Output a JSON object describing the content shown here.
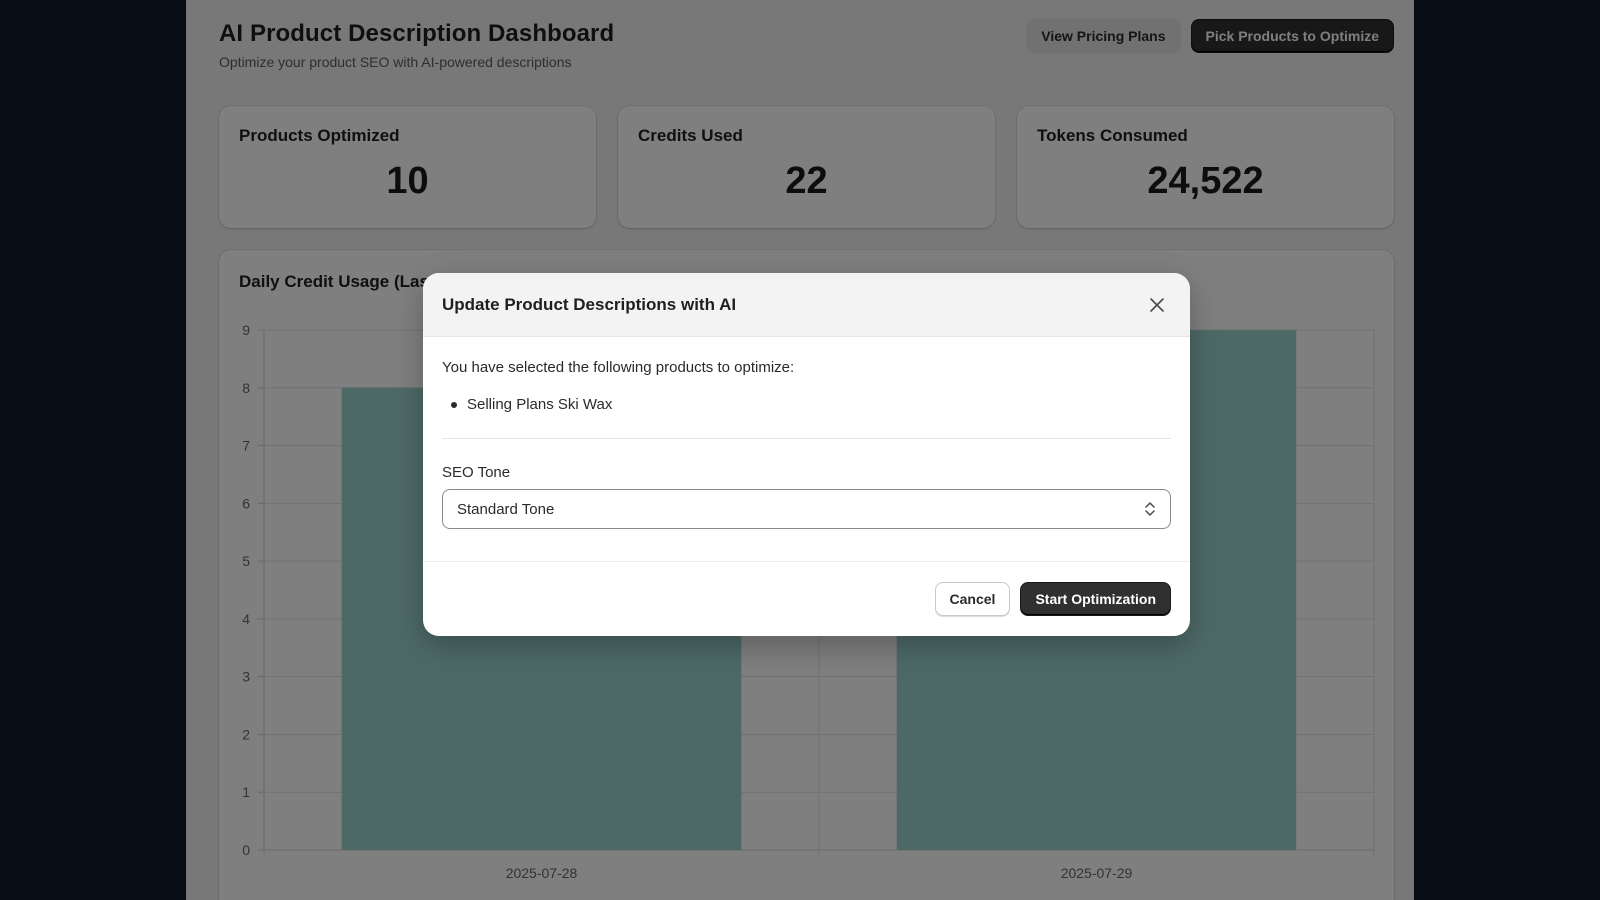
{
  "header": {
    "title": "AI Product Description Dashboard",
    "subtitle": "Optimize your product SEO with AI-powered descriptions",
    "view_pricing_label": "View Pricing Plans",
    "pick_products_label": "Pick Products to Optimize"
  },
  "stats": [
    {
      "label": "Products Optimized",
      "value": "10"
    },
    {
      "label": "Credits Used",
      "value": "22"
    },
    {
      "label": "Tokens Consumed",
      "value": "24,522"
    }
  ],
  "chart_card": {
    "title_visible": "Daily Credit Usage (Las"
  },
  "chart_data": {
    "type": "bar",
    "categories": [
      "2025-07-28",
      "2025-07-29"
    ],
    "values": [
      8,
      9
    ],
    "ylim": [
      0,
      9
    ],
    "yticks": [
      0,
      1,
      2,
      3,
      4,
      5,
      6,
      7,
      8,
      9
    ],
    "grid": true,
    "bar_color": "#9ad3cd"
  },
  "modal": {
    "title": "Update Product Descriptions with AI",
    "intro": "You have selected the following products to optimize:",
    "products": [
      "Selling Plans Ski Wax"
    ],
    "seo_label": "SEO Tone",
    "seo_value": "Standard Tone",
    "cancel_label": "Cancel",
    "start_label": "Start Optimization"
  },
  "icons": {
    "close": "close-icon",
    "select": "chevron-up-down-icon"
  }
}
